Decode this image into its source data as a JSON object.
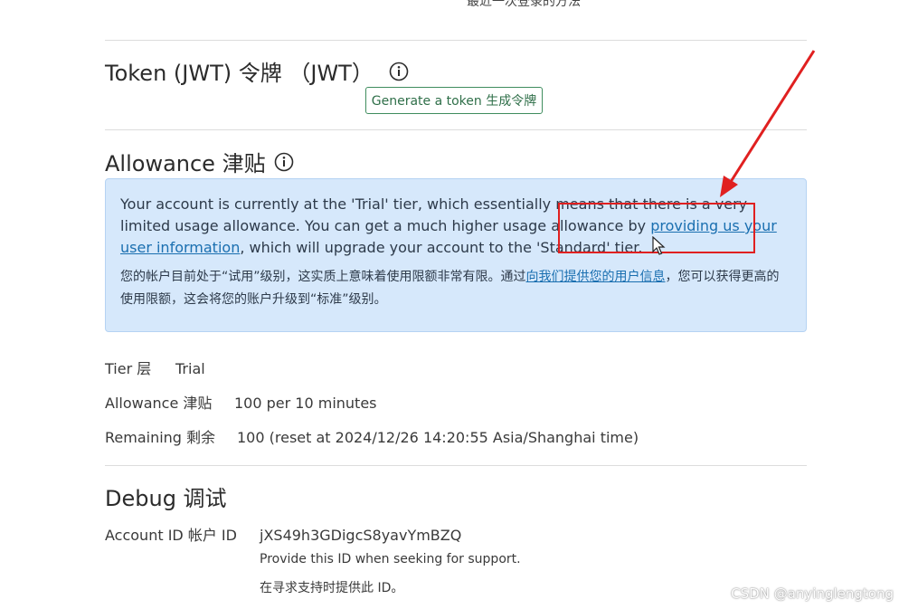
{
  "top_cut_text": "最近一次登录的方法",
  "token": {
    "title": "Token (JWT)  令牌 （JWT）",
    "button_label": "Generate a token  生成令牌"
  },
  "allowance": {
    "title": "Allowance  津贴",
    "alert": {
      "en_before": "Your account is currently at the 'Trial' tier, which essentially means that there is a very limited usage allowance. You can get a much higher usage allowance by ",
      "en_link": "providing us your user information",
      "en_after": ", which will upgrade your account to the 'Standard' tier.",
      "zh_before": "您的帐户目前处于“试用”级别，这实质上意味着使用限额非常有限。通过",
      "zh_link": "向我们提供您的用户信息",
      "zh_after": "，您可以获得更高的使用限额，这会将您的账户升级到“标准”级别。"
    },
    "tier_label": "Tier  层",
    "tier_value": "Trial",
    "allowance_label": "Allowance  津贴",
    "allowance_value": "100 per 10 minutes",
    "remaining_label": "Remaining  剩余",
    "remaining_value": "100 (reset at 2024/12/26 14:20:55 Asia/Shanghai time)"
  },
  "debug": {
    "title": "Debug  调试",
    "account_label": "Account ID  帐户 ID",
    "account_value": "jXS49h3GDigcS8yavYmBZQ",
    "note_en": "Provide this ID when seeking for support.",
    "note_zh": "在寻求支持时提供此 ID。"
  },
  "watermark": "CSDN @anyinglengtong",
  "colors": {
    "alert_bg": "#d6e8fb",
    "link": "#1a6fb0",
    "button_border": "#3f8d5e",
    "annotation_red": "#e02020"
  }
}
